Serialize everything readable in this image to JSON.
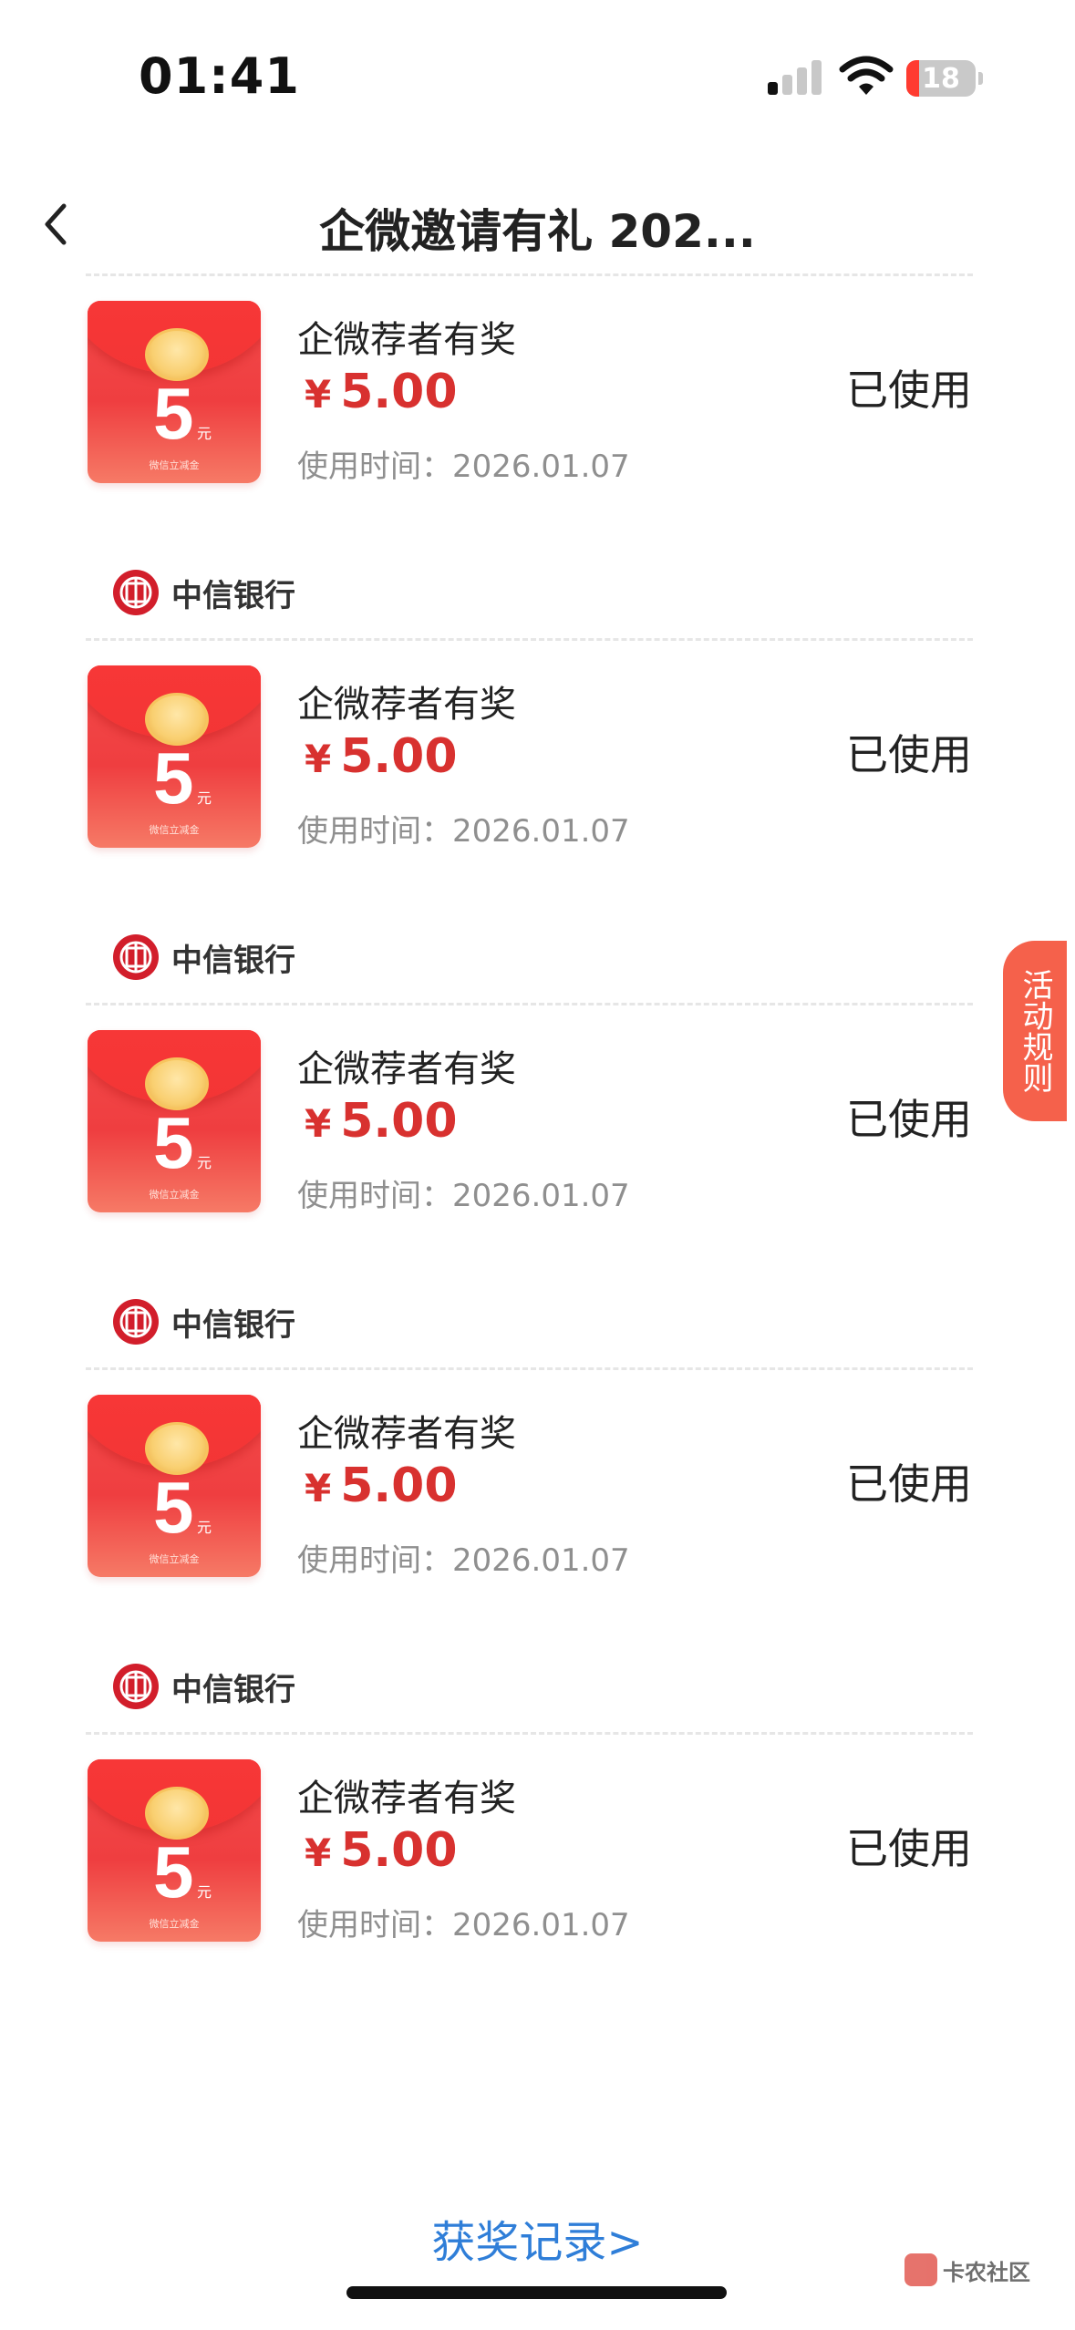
{
  "status_bar": {
    "time": "01:41",
    "battery": "18"
  },
  "nav": {
    "title": "企微邀请有礼 202..."
  },
  "cards": [
    {
      "bank": "",
      "title": "企微荐者有奖",
      "currency": "¥",
      "amount": "5.00",
      "use_time": "使用时间：2026.01.07",
      "status": "已使用",
      "packet_value": "5",
      "packet_unit": "元",
      "packet_caption": "微信立减金"
    },
    {
      "bank": "中信银行",
      "title": "企微荐者有奖",
      "currency": "¥",
      "amount": "5.00",
      "use_time": "使用时间：2026.01.07",
      "status": "已使用",
      "packet_value": "5",
      "packet_unit": "元",
      "packet_caption": "微信立减金"
    },
    {
      "bank": "中信银行",
      "title": "企微荐者有奖",
      "currency": "¥",
      "amount": "5.00",
      "use_time": "使用时间：2026.01.07",
      "status": "已使用",
      "packet_value": "5",
      "packet_unit": "元",
      "packet_caption": "微信立减金"
    },
    {
      "bank": "中信银行",
      "title": "企微荐者有奖",
      "currency": "¥",
      "amount": "5.00",
      "use_time": "使用时间：2026.01.07",
      "status": "已使用",
      "packet_value": "5",
      "packet_unit": "元",
      "packet_caption": "微信立减金"
    },
    {
      "bank": "中信银行",
      "title": "企微荐者有奖",
      "currency": "¥",
      "amount": "5.00",
      "use_time": "使用时间：2026.01.07",
      "status": "已使用",
      "packet_value": "5",
      "packet_unit": "元",
      "packet_caption": "微信立减金"
    }
  ],
  "floating": {
    "rules_label": "活动规则"
  },
  "footer": {
    "records_link": "获奖记录>"
  },
  "watermark": {
    "text": "卡农社区"
  },
  "colors": {
    "accent_red": "#d8312f",
    "link_blue": "#2f7ed8",
    "rules_bg": "#f5614b"
  },
  "icons": [
    "back-chevron-icon",
    "signal-icon",
    "wifi-icon",
    "battery-icon",
    "citic-bank-logo-icon"
  ]
}
